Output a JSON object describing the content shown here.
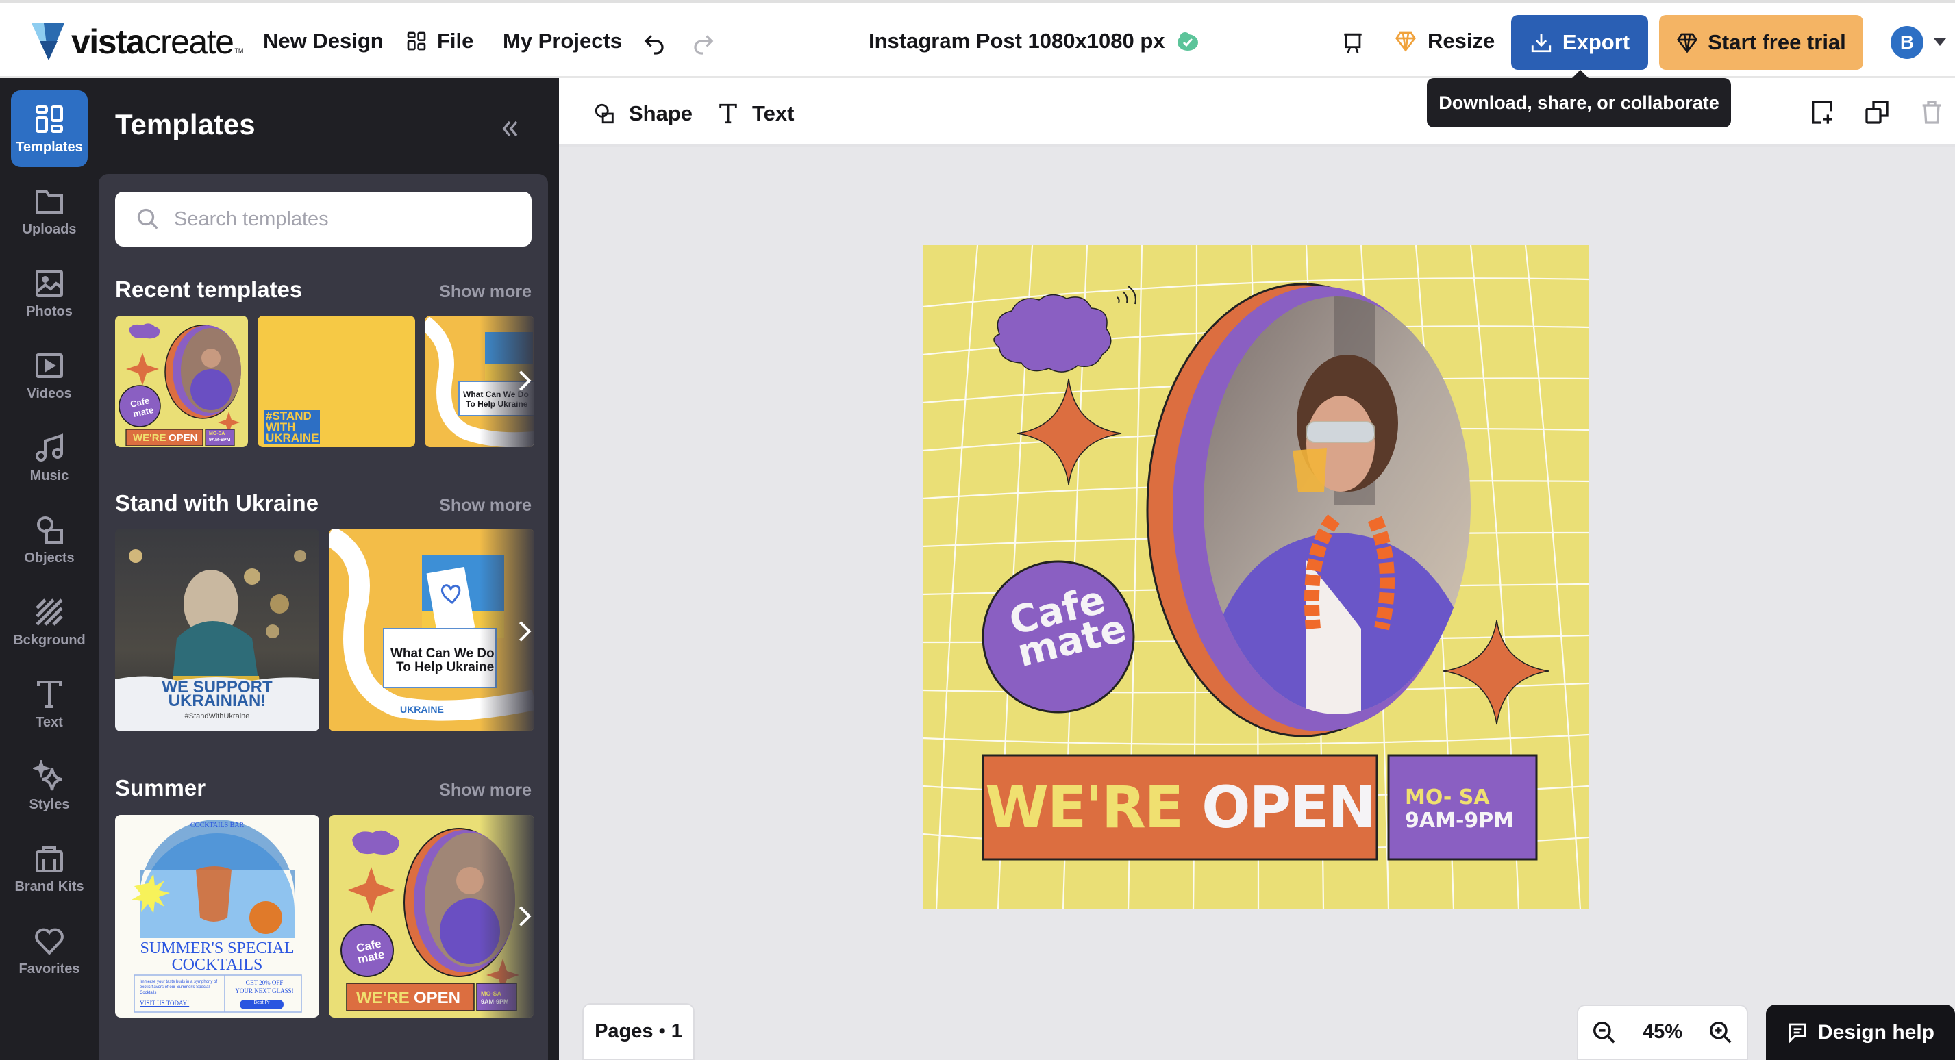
{
  "app": {
    "logo_bold": "vista",
    "logo_light": "create",
    "logo_tm": "TM"
  },
  "topbar": {
    "new_design": "New Design",
    "file": "File",
    "my_projects": "My Projects",
    "doc_title": "Instagram Post 1080x1080 px",
    "resize": "Resize",
    "export": "Export",
    "start_trial": "Start free trial",
    "avatar_initial": "B",
    "colors": {
      "export": "#2a5fb4",
      "trial": "#f4b464",
      "avatar": "#2d6fc4",
      "saved": "#5cc49a"
    }
  },
  "tooltip": {
    "text": "Download, share, or collaborate"
  },
  "rail": {
    "items": [
      {
        "label": "Templates",
        "icon": "templates-icon",
        "active": true
      },
      {
        "label": "Uploads",
        "icon": "folder-icon"
      },
      {
        "label": "Photos",
        "icon": "image-icon"
      },
      {
        "label": "Videos",
        "icon": "video-icon"
      },
      {
        "label": "Music",
        "icon": "music-note-icon"
      },
      {
        "label": "Objects",
        "icon": "shapes-icon"
      },
      {
        "label": "Bckground",
        "icon": "background-stripes-icon"
      },
      {
        "label": "Text",
        "icon": "text-t-icon"
      },
      {
        "label": "Styles",
        "icon": "sparkle-icon"
      },
      {
        "label": "Brand Kits",
        "icon": "briefcase-icon"
      },
      {
        "label": "Favorites",
        "icon": "heart-icon"
      }
    ]
  },
  "panel": {
    "title": "Templates",
    "search_placeholder": "Search templates",
    "show_more": "Show more",
    "sections": [
      {
        "title": "Recent templates"
      },
      {
        "title": "Stand with Ukraine"
      },
      {
        "title": "Summer"
      }
    ],
    "thumbs": {
      "cafe": {
        "cloud": "",
        "cafe_line1": "Cafe",
        "cafe_line2": "mate",
        "were": "WE'RE",
        "open": "OPEN",
        "days": "MO-SA",
        "hours": "9AM-9PM"
      },
      "stand": {
        "line1": "#STAND",
        "line2": "WITH",
        "line3": "UKRAINE"
      },
      "help": {
        "q1": "What Can We Do",
        "q2": "To Help Ukraine",
        "ribbon": "UKRAINE"
      },
      "support": {
        "line1": "WE SUPPORT",
        "line2": "UKRAINIAN!",
        "tag": "#StandWithUkraine"
      },
      "cocktails": {
        "bar": "COCKTAILS BAR",
        "title1": "SUMMER'S SPECIAL",
        "title2": "COCKTAILS",
        "body": "Immerse your taste buds in a symphony of exotic flavors of our Summer's Special Cocktails",
        "visit": "VISIT US TODAY!",
        "offer1": "GET 20% OFF",
        "offer2": "YOUR NEXT GLASS!",
        "cta": "Best Pr"
      }
    }
  },
  "toolbar": {
    "shape": "Shape",
    "text": "Text"
  },
  "design": {
    "cafe_line1": "Cafe",
    "cafe_line2": "mate",
    "were": "WE'RE",
    "open": "OPEN",
    "days": "MO- SA",
    "hours": "9AM-9PM",
    "colors": {
      "bg": "#eadf76",
      "orange": "#dc6e40",
      "purple": "#8a5fc2",
      "yellow_text": "#f0e070",
      "white_text": "#f5f3f6"
    }
  },
  "footer": {
    "pages": "Pages • 1",
    "zoom": "45%",
    "help": "Design help"
  }
}
